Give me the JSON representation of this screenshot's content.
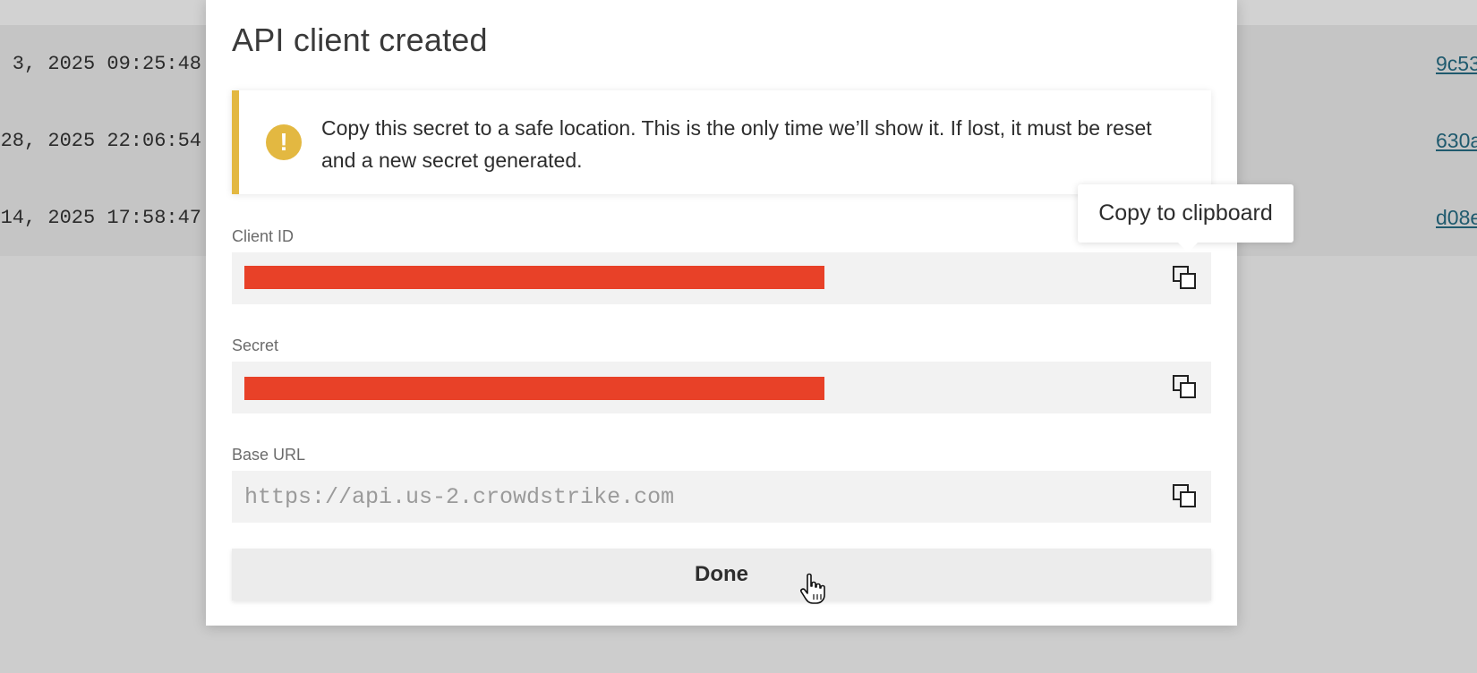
{
  "background": {
    "rows": [
      {
        "timestamp": "3, 2025 09:25:48",
        "link": "9c53"
      },
      {
        "timestamp": "28, 2025 22:06:54",
        "link": "630a"
      },
      {
        "timestamp": "14, 2025 17:58:47",
        "link": "d08e"
      }
    ]
  },
  "modal": {
    "title": "API client created",
    "alert": {
      "icon": "exclamation-icon",
      "icon_glyph": "!",
      "color": "#e3b841",
      "message": "Copy this secret to a safe location. This is the only time we’ll show it. If lost, it must be reset and a new secret generated."
    },
    "fields": {
      "client_id": {
        "label": "Client ID",
        "value": "",
        "redacted": true
      },
      "secret": {
        "label": "Secret",
        "value": "",
        "redacted": true
      },
      "base_url": {
        "label": "Base URL",
        "value": "https://api.us-2.crowdstrike.com"
      }
    },
    "copy_icon": "copy-icon",
    "done_label": "Done"
  },
  "tooltip": {
    "text": "Copy to clipboard"
  },
  "colors": {
    "redaction": "#e84128",
    "accent_warning": "#e3b841",
    "link": "#1f5a6e"
  }
}
